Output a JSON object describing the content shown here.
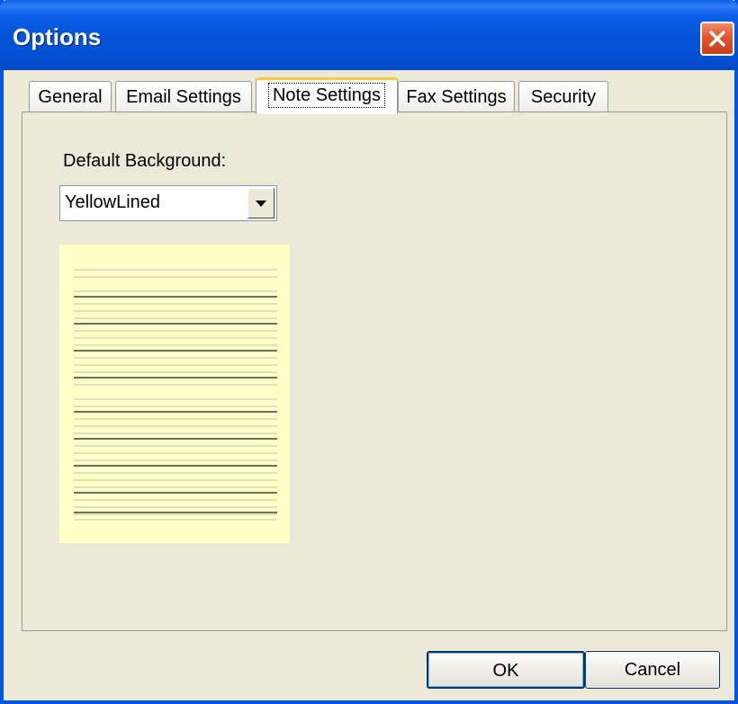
{
  "window": {
    "title": "Options"
  },
  "tabs": [
    {
      "label": "General"
    },
    {
      "label": "Email Settings"
    },
    {
      "label": "Note Settings",
      "active": true
    },
    {
      "label": "Fax Settings"
    },
    {
      "label": "Security"
    }
  ],
  "note_settings": {
    "default_background_label": "Default Background:",
    "background_select": {
      "selected": "YellowLined"
    },
    "preview": {
      "paper_color": "#FFFFC8",
      "line_color": "#3F3F3F"
    }
  },
  "buttons": {
    "ok": "OK",
    "cancel": "Cancel"
  },
  "icons": {
    "close": "close-icon",
    "dropdown": "dropdown-arrow-icon"
  },
  "colors": {
    "titlebar": "#0453D8",
    "close_button": "#E2552E",
    "dialog_bg": "#ECE9D8",
    "active_tab_highlight": "#FFC73C"
  }
}
